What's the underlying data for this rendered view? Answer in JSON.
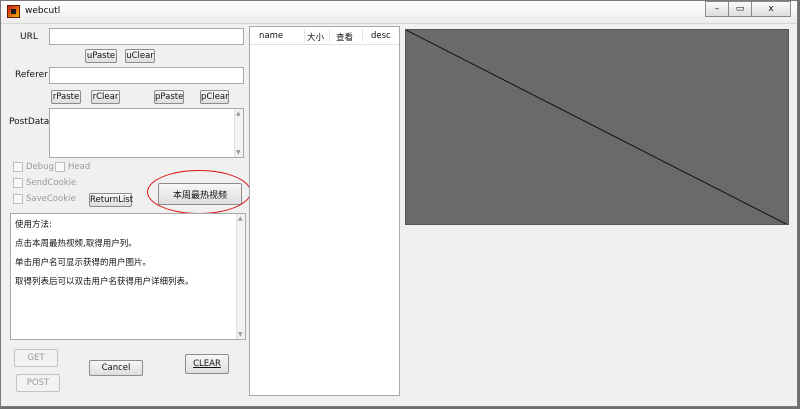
{
  "window": {
    "title": "webcutl",
    "buttons": {
      "minimize": "–",
      "maximize": "▭",
      "close": "x"
    }
  },
  "form": {
    "url_label": "URL",
    "url_value": "",
    "upaste": "uPaste",
    "uclear": "uClear",
    "referer_label": "Referer",
    "referer_value": "",
    "rpaste": "rPaste",
    "rclear": "rClear",
    "ppaste": "pPaste",
    "pclear": "pClear",
    "postdata_label": "PostData",
    "postdata_value": ""
  },
  "options": {
    "debug": "Debug",
    "head": "Head",
    "sendcookie": "SendCookie",
    "savecookie": "SaveCookie",
    "returnlist": "ReturnList",
    "hot_button": "本周最热视频"
  },
  "usage": {
    "lines": [
      "使用方法:",
      "点击本周最热视频,取得用户列。",
      "单击用户名可显示获得的用户图片。",
      "取得列表后可以双击用户名获得用户详细列表。"
    ]
  },
  "actions": {
    "get": "GET",
    "post": "POST",
    "cancel": "Cancel",
    "clear": "CLEAR"
  },
  "list": {
    "columns": [
      "name",
      "大小",
      "查看",
      "desc"
    ]
  },
  "colors": {
    "preview_bg": "#6a6a6a",
    "highlight": "#dd1111"
  },
  "icons": {
    "app": "app-icon"
  }
}
